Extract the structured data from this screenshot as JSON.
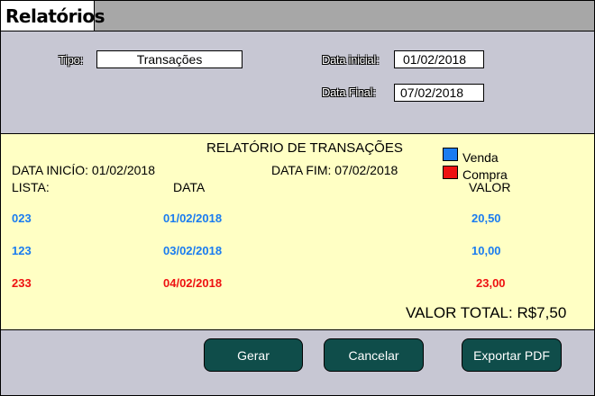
{
  "window": {
    "title": "Relatórios"
  },
  "form": {
    "tipo_label": "Tipo:",
    "tipo_value": "Transações",
    "data_inicial_label": "Data inicial:",
    "data_inicial_value": "01/02/2018",
    "data_final_label": "Data Final:",
    "data_final_value": "07/02/2018"
  },
  "report": {
    "title": "RELATÓRIO DE TRANSAÇÕES",
    "data_inicio": "DATA INICÍO: 01/02/2018",
    "data_fim": "DATA FIM: 07/02/2018",
    "legend": [
      {
        "label": "Venda",
        "color": "#1a7cf0"
      },
      {
        "label": "Compra",
        "color": "#ee1111"
      }
    ],
    "columns": {
      "lista": "LISTA:",
      "data": "DATA",
      "valor": "VALOR"
    },
    "rows": [
      {
        "lista": "023",
        "data": "01/02/2018",
        "valor": "20,50",
        "type": "Venda",
        "color": "#1a7cf0"
      },
      {
        "lista": "123",
        "data": "03/02/2018",
        "valor": "10,00",
        "type": "Venda",
        "color": "#1a7cf0"
      },
      {
        "lista": "233",
        "data": "04/02/2018",
        "valor": "23,00",
        "type": "Compra",
        "color": "#ee1111"
      }
    ],
    "total": "VALOR TOTAL: R$7,50"
  },
  "buttons": {
    "gerar": "Gerar",
    "cancelar": "Cancelar",
    "exportar": "Exportar PDF"
  }
}
